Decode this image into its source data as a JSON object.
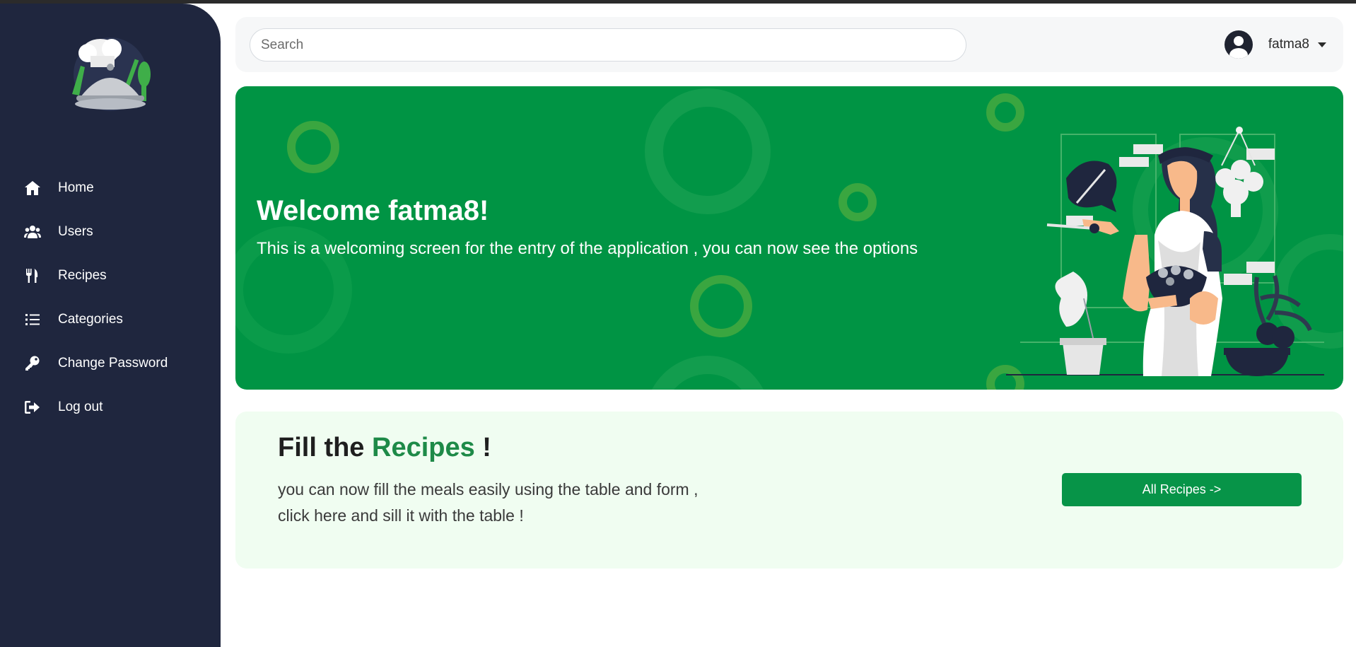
{
  "sidebar": {
    "items": [
      {
        "label": "Home",
        "icon": "home-icon"
      },
      {
        "label": "Users",
        "icon": "users-icon"
      },
      {
        "label": "Recipes",
        "icon": "utensils-icon"
      },
      {
        "label": "Categories",
        "icon": "list-icon"
      },
      {
        "label": "Change Password",
        "icon": "key-icon"
      },
      {
        "label": "Log out",
        "icon": "logout-icon"
      }
    ]
  },
  "header": {
    "search_placeholder": "Search",
    "user_name": "fatma8"
  },
  "hero": {
    "title": "Welcome fatma8!",
    "subtitle": "This is a welcoming screen for the entry of the application , you can now see the options"
  },
  "fill": {
    "title_prefix": "Fill the ",
    "title_highlight": "Recipes",
    "title_suffix": " !",
    "line1": "you can now fill the meals easily using the table and form ,",
    "line2": "click here and sill it with the table !",
    "button_label": "All Recipes ->"
  },
  "colors": {
    "sidebar_bg": "#1f263e",
    "hero_bg": "#009444",
    "accent": "#1e8a48",
    "button_bg": "#079448",
    "fill_bg": "#f0fdf1"
  }
}
